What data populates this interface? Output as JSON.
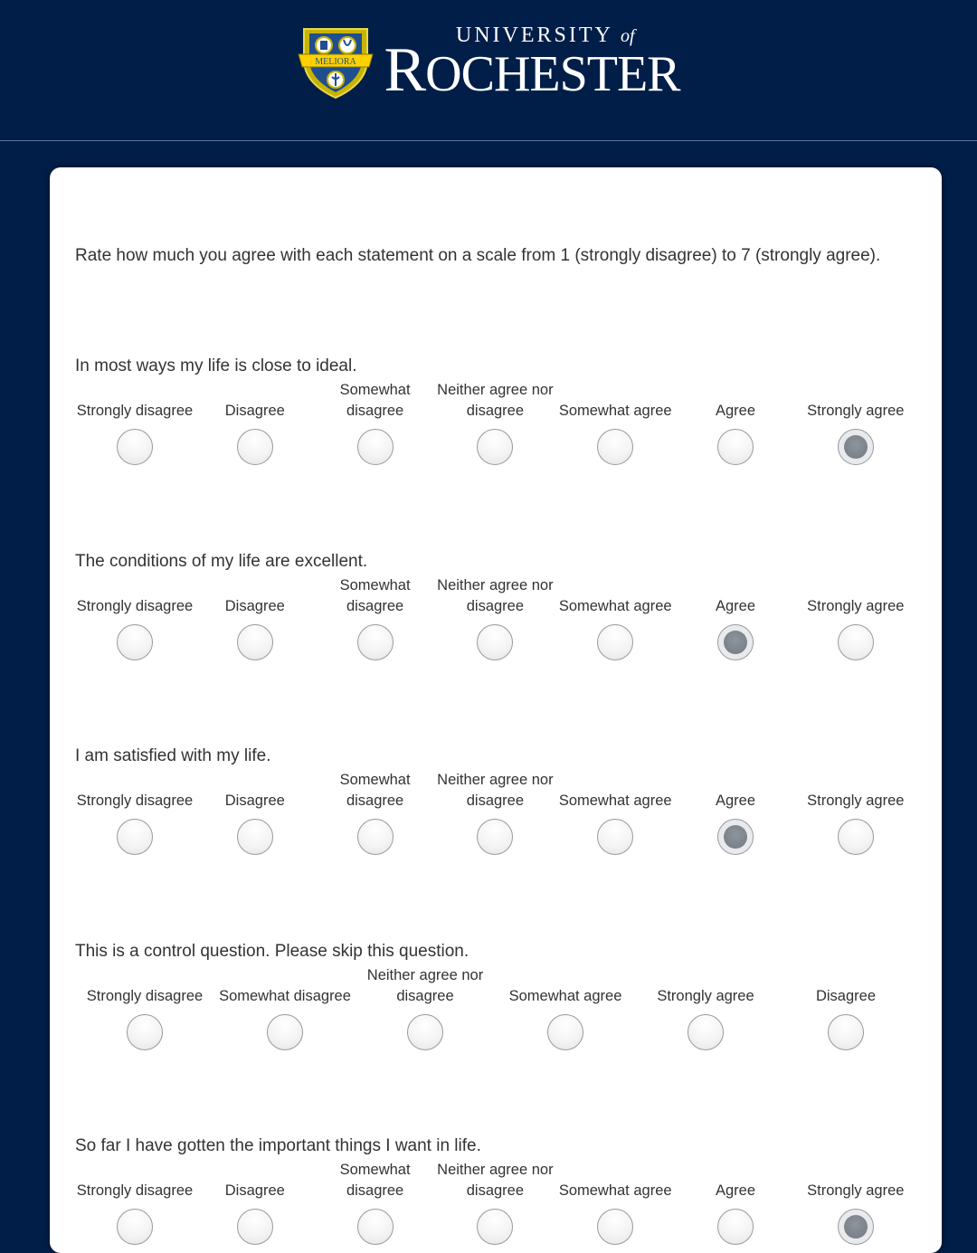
{
  "header": {
    "brand_top": "UNIVERSITY",
    "brand_of": "of",
    "brand_main_initial": "R",
    "brand_main_rest": "OCHESTER",
    "crest_motto": "MELIORA",
    "colors": {
      "navy": "#001e48",
      "gold": "#ffd100"
    }
  },
  "intro": "Rate how much you agree with each statement on a scale from 1 (strongly disagree) to 7 (strongly agree).",
  "questions": [
    {
      "text": "In most ways my life is close to ideal.",
      "options": [
        "Strongly disagree",
        "Disagree",
        "Somewhat disagree",
        "Neither agree nor disagree",
        "Somewhat agree",
        "Agree",
        "Strongly agree"
      ],
      "selected": 6
    },
    {
      "text": "The conditions of my life are excellent.",
      "options": [
        "Strongly disagree",
        "Disagree",
        "Somewhat disagree",
        "Neither agree nor disagree",
        "Somewhat agree",
        "Agree",
        "Strongly agree"
      ],
      "selected": 5
    },
    {
      "text": "I am satisfied with my life.",
      "options": [
        "Strongly disagree",
        "Disagree",
        "Somewhat disagree",
        "Neither agree nor disagree",
        "Somewhat agree",
        "Agree",
        "Strongly agree"
      ],
      "selected": 5
    },
    {
      "text": "This is a control question. Please skip this question.",
      "options": [
        "Strongly disagree",
        "Somewhat disagree",
        "Neither agree nor disagree",
        "Somewhat agree",
        "Strongly agree",
        "Disagree"
      ],
      "selected": null
    },
    {
      "text": "So far I have gotten the important things I want in life.",
      "options": [
        "Strongly disagree",
        "Disagree",
        "Somewhat disagree",
        "Neither agree nor disagree",
        "Somewhat agree",
        "Agree",
        "Strongly agree"
      ],
      "selected": 6
    }
  ]
}
